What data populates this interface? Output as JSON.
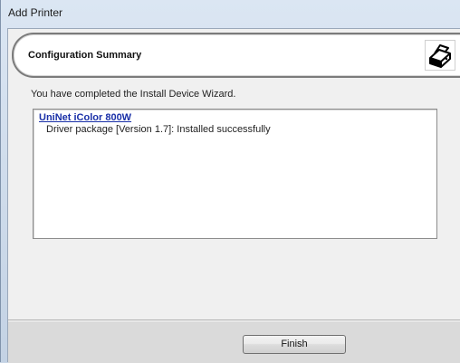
{
  "window": {
    "title": "Add Printer"
  },
  "header": {
    "title": "Configuration Summary",
    "icon": "printer-wizard-icon"
  },
  "main": {
    "message": "You have completed the Install Device Wizard.",
    "results": {
      "device_name": "UniNet iColor 800W",
      "driver_status": "Driver package [Version 1.7]: Installed successfully"
    }
  },
  "footer": {
    "finish_label": "Finish"
  },
  "colors": {
    "link": "#1a30a8",
    "client_background": "#f0f0f0",
    "footer_background": "#dadada"
  }
}
